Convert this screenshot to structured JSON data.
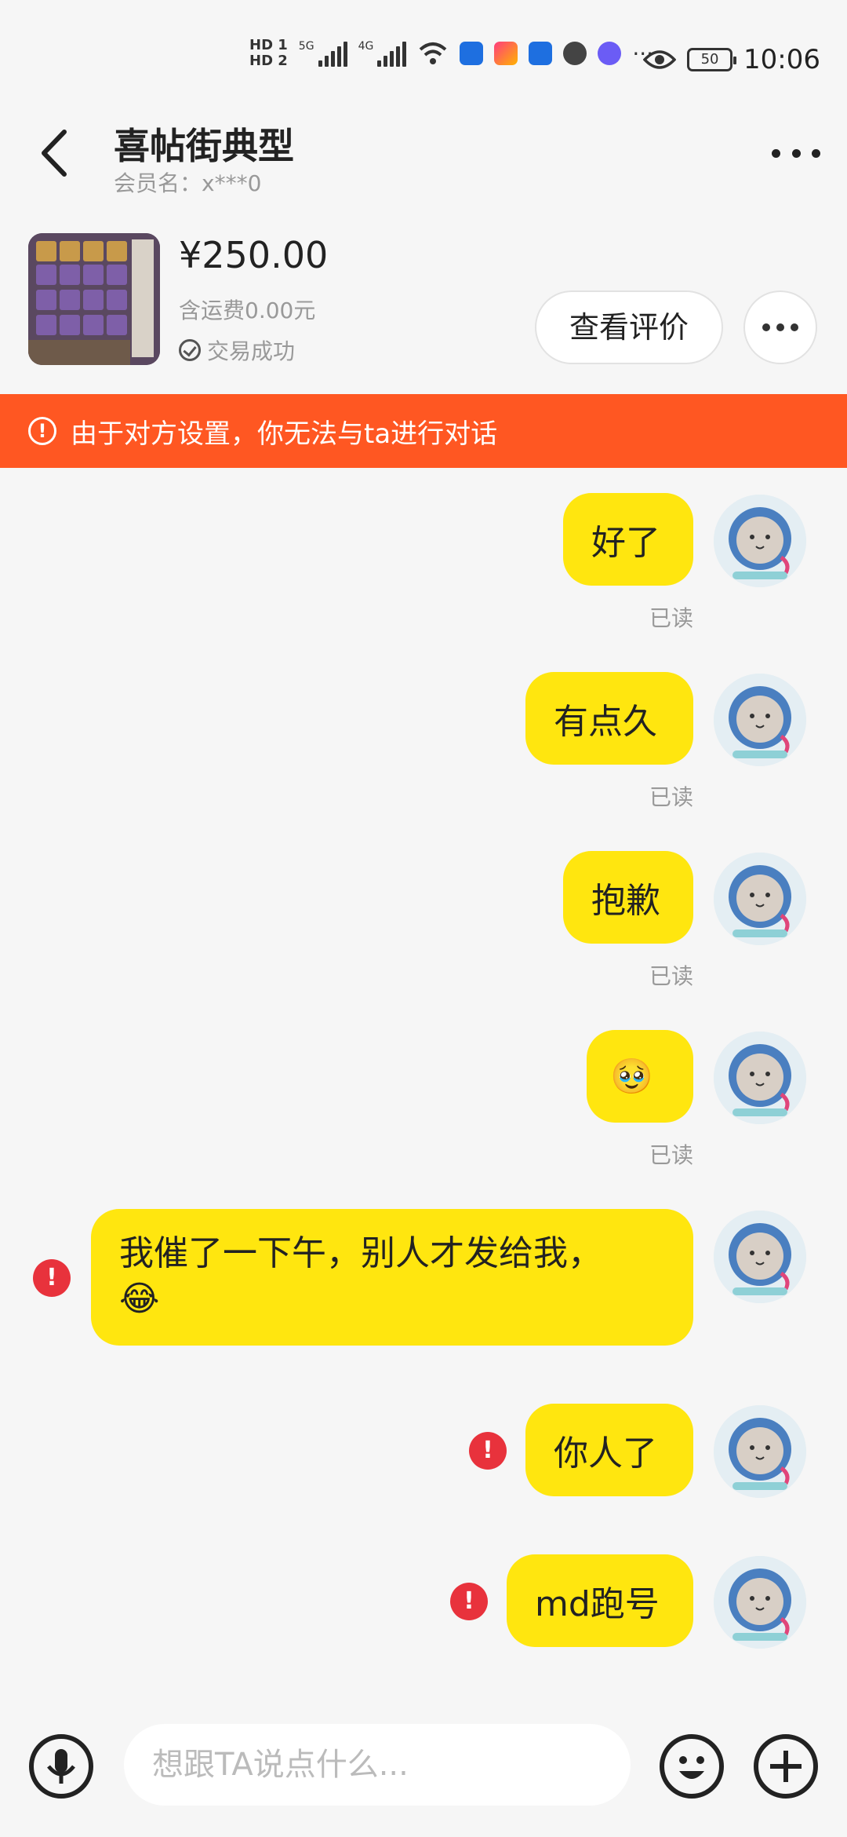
{
  "status_bar": {
    "hd1": "HD 1",
    "hd2": "HD 2",
    "sig1_label": "5G",
    "sig2_label": "4G",
    "battery": "50",
    "time": "10:06",
    "more": "···"
  },
  "header": {
    "title": "喜帖街典型",
    "member_label": "会员名：x***0"
  },
  "product": {
    "price": "¥250.00",
    "shipping": "含运费0.00元",
    "status": "交易成功",
    "view_reviews": "查看评价"
  },
  "banner": {
    "icon": "!",
    "text": "由于对方设置，你无法与ta进行对话"
  },
  "messages": [
    {
      "text": "好了",
      "read": "已读"
    },
    {
      "text": "有点久",
      "read": "已读"
    },
    {
      "text": "抱歉",
      "read": "已读"
    },
    {
      "text": "🥹",
      "read": "已读"
    },
    {
      "text": "我催了一下午，别人才发给我，😂",
      "failed": "!"
    },
    {
      "text": "你人了",
      "failed": "!"
    },
    {
      "text": "md跑号",
      "failed": "!"
    }
  ],
  "input": {
    "placeholder": "想跟TA说点什么..."
  },
  "colors": {
    "bubble": "#ffe60f",
    "banner": "#ff5722",
    "error": "#e8323c",
    "background": "#f6f6f6"
  }
}
